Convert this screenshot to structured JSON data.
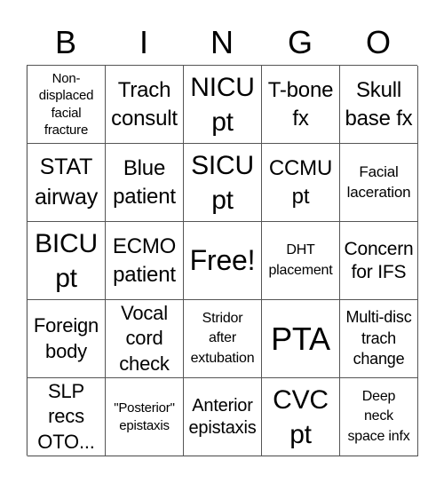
{
  "header": {
    "letters": [
      "B",
      "I",
      "N",
      "G",
      "O"
    ]
  },
  "board": {
    "rows": [
      [
        "Non-\ndisplaced\nfacial\nfracture",
        "Trach\nconsult",
        "NICU\npt",
        "T-bone\nfx",
        "Skull\nbase fx"
      ],
      [
        "STAT\nairway",
        "Blue\npatient",
        "SICU\npt",
        "CCMU\npt",
        "Facial\nlaceration"
      ],
      [
        "BICU\npt",
        "ECMO\npatient",
        "Free!",
        "DHT\nplacement",
        "Concern\nfor IFS"
      ],
      [
        "Foreign\nbody",
        "Vocal\ncord\ncheck",
        "Stridor\nafter\nextubation",
        "PTA",
        "Multi-disc\ntrach\nchange"
      ],
      [
        "SLP\nrecs\nOTO...",
        "\"Posterior\"\nepistaxis",
        "Anterior\nepistaxis",
        "CVC\npt",
        "Deep\nneck\nspace infx"
      ]
    ]
  }
}
